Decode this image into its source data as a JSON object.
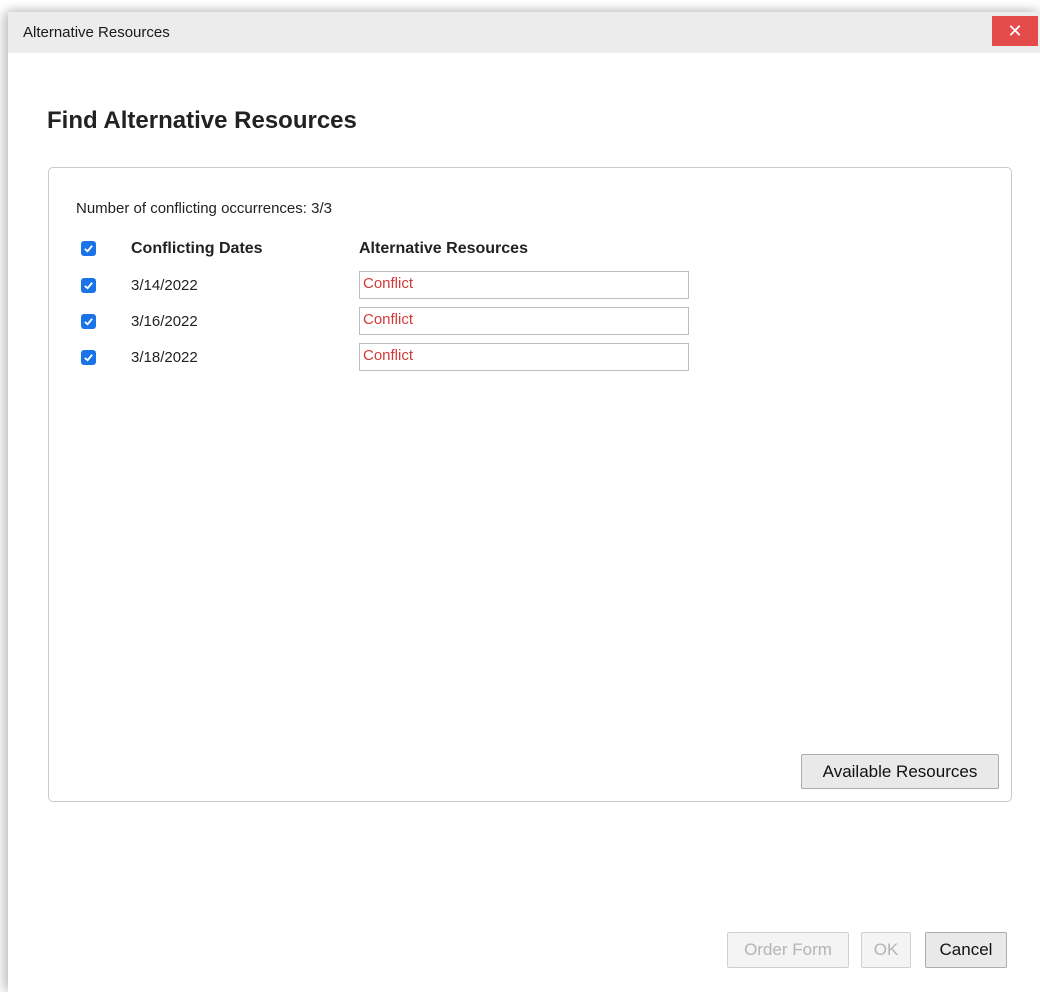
{
  "window": {
    "title": "Alternative Resources",
    "close_symbol": "✕"
  },
  "heading": "Find Alternative Resources",
  "panel": {
    "count_line": "Number of conflicting occurrences: 3/3",
    "columns": {
      "dates": "Conflicting Dates",
      "resources": "Alternative Resources"
    },
    "rows": [
      {
        "date": "3/14/2022",
        "resource": "Conflict",
        "checked": true
      },
      {
        "date": "3/16/2022",
        "resource": "Conflict",
        "checked": true
      },
      {
        "date": "3/18/2022",
        "resource": "Conflict",
        "checked": true
      }
    ],
    "available_button": "Available Resources"
  },
  "footer": {
    "order_form": "Order Form",
    "ok": "OK",
    "cancel": "Cancel"
  },
  "colors": {
    "checkbox": "#1a73e8",
    "conflict_text": "#d23a3a",
    "close_button": "#e44b4b"
  }
}
